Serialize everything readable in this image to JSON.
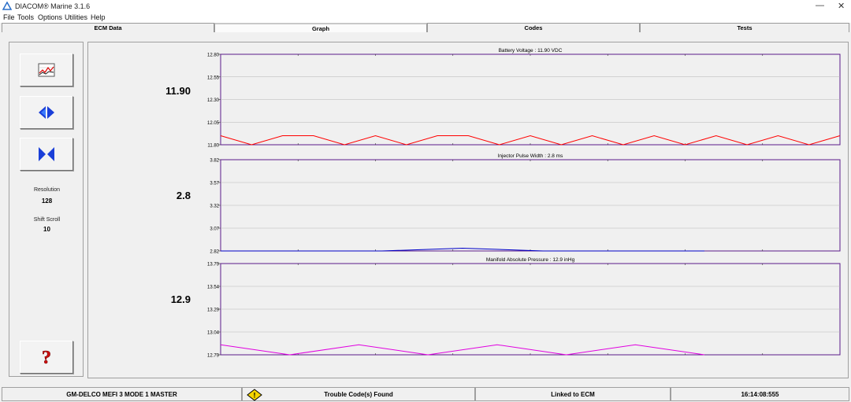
{
  "window": {
    "title": "DIACOM® Marine 3.1.6",
    "minimize": "—",
    "close": "✕"
  },
  "menu": [
    "File",
    "Tools",
    "Options",
    "Utilities",
    "Help"
  ],
  "tabs": [
    "ECM Data",
    "Graph",
    "Codes",
    "Tests"
  ],
  "active_tab": "Graph",
  "left_panel": {
    "buttons": [
      "graph-view-icon",
      "expand-horizontal-icon",
      "compress-horizontal-icon",
      "help-icon"
    ],
    "resolution_label": "Resolution",
    "resolution_value": "128",
    "shift_scroll_label": "Shift Scroll",
    "shift_scroll_value": "10"
  },
  "readouts": [
    "11.90",
    "2.8",
    "12.9"
  ],
  "chart_data": [
    {
      "type": "line",
      "title": "Battery Voltage :  11.90 VDC",
      "yticks": [
        "12.80",
        "12.55",
        "12.30",
        "12.05",
        "11.80"
      ],
      "ylim": [
        11.8,
        12.8
      ],
      "color": "#ff0000",
      "baseline": 11.9,
      "series": [
        {
          "values": [
            11.9,
            11.8,
            11.9,
            11.9,
            11.8,
            11.9,
            11.8,
            11.9,
            11.9,
            11.8,
            11.9,
            11.8,
            11.9,
            11.8,
            11.9,
            11.8,
            11.9,
            11.8,
            11.9,
            11.8,
            11.9
          ]
        }
      ]
    },
    {
      "type": "line",
      "title": "Injector Pulse Width :  2.8 ms",
      "yticks": [
        "3.82",
        "3.57",
        "3.32",
        "3.07",
        "2.82"
      ],
      "ylim": [
        2.82,
        3.82
      ],
      "color": "#0000c8",
      "series": [
        {
          "values": [
            2.82,
            2.82,
            2.82,
            2.85,
            2.82,
            2.82,
            2.82
          ]
        }
      ]
    },
    {
      "type": "line",
      "title": "Manifold Absolute Pressure :  12.9 inHg",
      "yticks": [
        "13.79",
        "13.54",
        "13.29",
        "13.04",
        "12.79"
      ],
      "ylim": [
        12.79,
        13.79
      ],
      "color": "#e000e0",
      "series": [
        {
          "values": [
            12.9,
            12.79,
            12.9,
            12.79,
            12.9,
            12.79,
            12.9,
            12.79
          ]
        }
      ]
    }
  ],
  "status_bar": {
    "device": "GM-DELCO MEFI 3 MODE 1 MASTER",
    "codes": "Trouble Code(s) Found",
    "link": "Linked to ECM",
    "time": "16:14:08:555"
  }
}
